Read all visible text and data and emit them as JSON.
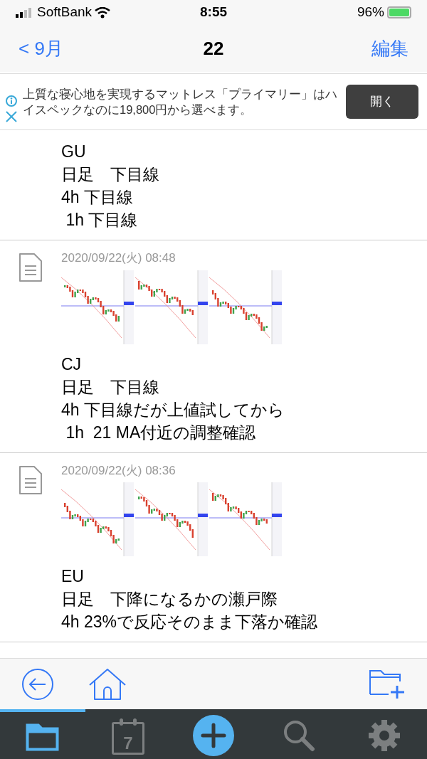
{
  "status_bar": {
    "carrier": "SoftBank",
    "time": "8:55",
    "battery": "96%"
  },
  "nav": {
    "back": "< 9月",
    "title": "22",
    "edit": "編集"
  },
  "ad": {
    "text": "上質な寝心地を実現するマットレス「プライマリー」はハイスペックなのに19,800円から選べます。",
    "button": "開く"
  },
  "entries": [
    {
      "has_thumbnail": false,
      "lines": [
        "GU",
        "日足　下目線",
        "4h 下目線",
        " 1h 下目線"
      ]
    },
    {
      "date": "2020/09/22(火) 08:48",
      "has_thumbnail": true,
      "lines": [
        "CJ",
        "日足　下目線",
        "4h 下目線だが上値試してから",
        " 1h  21 MA付近の調整確認"
      ]
    },
    {
      "date": "2020/09/22(火) 08:36",
      "has_thumbnail": true,
      "lines": [
        "EU",
        "日足　下降になるかの瀬戸際",
        "4h 23%で反応そのまま下落か確認"
      ]
    }
  ],
  "tabs": [
    {
      "kind": "folder",
      "selected": true
    },
    {
      "kind": "calendar",
      "label": "7",
      "selected": false
    },
    {
      "kind": "add",
      "selected": false
    },
    {
      "kind": "search",
      "selected": false
    },
    {
      "kind": "settings",
      "selected": false
    }
  ]
}
